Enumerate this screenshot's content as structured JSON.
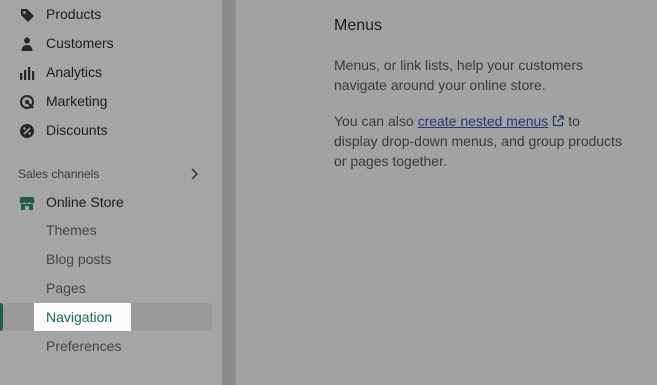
{
  "sidebar": {
    "items": [
      {
        "label": "Products",
        "icon": "tag-icon"
      },
      {
        "label": "Customers",
        "icon": "person-icon"
      },
      {
        "label": "Analytics",
        "icon": "bar-chart-icon"
      },
      {
        "label": "Marketing",
        "icon": "target-icon"
      },
      {
        "label": "Discounts",
        "icon": "discount-icon"
      }
    ],
    "sales_channels_label": "Sales channels",
    "online_store": {
      "label": "Online Store",
      "icon": "store-icon"
    },
    "sub_items": [
      {
        "label": "Themes"
      },
      {
        "label": "Blog posts"
      },
      {
        "label": "Pages"
      },
      {
        "label": "Navigation",
        "active": true
      },
      {
        "label": "Preferences"
      }
    ]
  },
  "main": {
    "title": "Menus",
    "description": "Menus, or link lists, help your customers navigate around your online store.",
    "nested_prefix": "You can also ",
    "nested_link": "create nested menus",
    "nested_suffix": " to display drop-down menus, and group products or pages together."
  },
  "colors": {
    "accent_green": "#1a6a4d",
    "link_blue": "#213a70"
  }
}
